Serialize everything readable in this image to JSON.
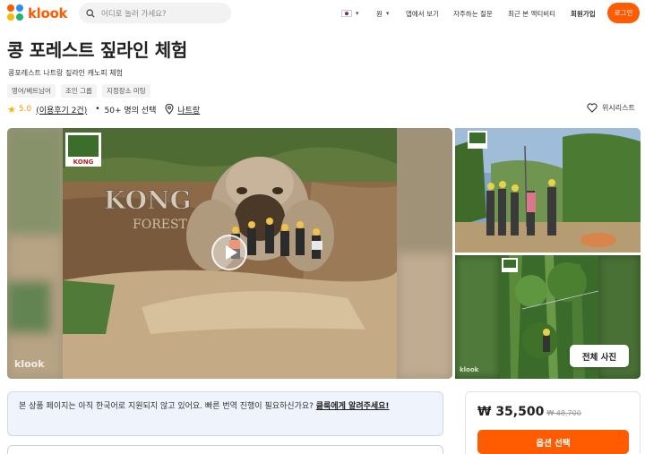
{
  "header": {
    "logo_text": "klook",
    "search_placeholder": "어디로 놀러 가세요?",
    "currency": "원",
    "nav_items": [
      "앱에서 보기",
      "자주하는 질문",
      "최근 본 액티비티",
      "회원가입"
    ],
    "login_label": "로그인",
    "accent_color": "#ff5b00"
  },
  "product": {
    "title": "콩 포레스트 짚라인 체험",
    "subtitle": "콩포레스트 나트랑 짚라인 캐노피 체험",
    "tags": [
      "영어/베트남어",
      "조인 그룹",
      "지정장소 미팅"
    ],
    "rating": "5.0",
    "reviews_link": "(이용후기 2건)",
    "booked": "50+ 명의 선택",
    "location": "나트랑",
    "wishlist_label": "위시리스트"
  },
  "gallery": {
    "watermark": "klook",
    "sign_text": "KONG",
    "all_photos_label": "전체 사진"
  },
  "notice": {
    "text": "본 상품 페이지는 아직 한국어로 지원되지 않고 있어요. 빠른 번역 진행이 필요하신가요? ",
    "link": "클룩에게 알려주세요!"
  },
  "booking": {
    "price": "₩ 35,500",
    "original_price": "₩ 48,700",
    "select_label": "옵션 선택"
  }
}
